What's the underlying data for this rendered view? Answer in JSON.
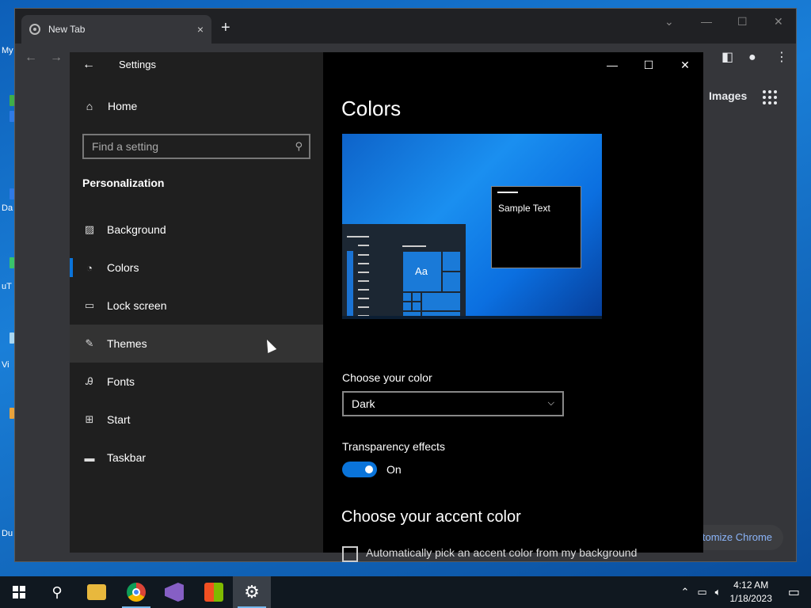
{
  "desktop": {
    "labels": [
      "My",
      "Da",
      "uT",
      "Vi",
      "Du"
    ],
    "icon_colors": [
      "#3fae49",
      "#2f7ae5",
      "#39c46b",
      "#a9d7f2",
      "#e8a33d"
    ]
  },
  "chrome": {
    "tab_title": "New Tab",
    "tab_close": "×",
    "new_tab": "+",
    "images_link": "Images",
    "customize": "tomize Chrome"
  },
  "settings": {
    "app_title": "Settings",
    "home_label": "Home",
    "search_placeholder": "Find a setting",
    "section_title": "Personalization",
    "nav": [
      {
        "label": "Background",
        "icon": "image-icon"
      },
      {
        "label": "Colors",
        "icon": "palette-icon",
        "selected": true
      },
      {
        "label": "Lock screen",
        "icon": "lock-screen-icon"
      },
      {
        "label": "Themes",
        "icon": "themes-icon",
        "hover": true
      },
      {
        "label": "Fonts",
        "icon": "fonts-icon"
      },
      {
        "label": "Start",
        "icon": "start-icon"
      },
      {
        "label": "Taskbar",
        "icon": "taskbar-icon"
      }
    ],
    "page_title": "Colors",
    "preview_tile_text": "Aa",
    "preview_sample_text": "Sample Text",
    "choose_color_label": "Choose your color",
    "choose_color_value": "Dark",
    "transparency_label": "Transparency effects",
    "transparency_state": "On",
    "accent_title": "Choose your accent color",
    "auto_accent_label": "Automatically pick an accent color from my background"
  },
  "taskbar": {
    "apps": [
      "file-explorer-icon",
      "chrome-icon",
      "visual-studio-icon",
      "store-icon",
      "settings-icon"
    ],
    "time": "4:12 AM",
    "date": "1/18/2023"
  },
  "colors": {
    "accent": "#0a74da",
    "sidebar_bg": "#1f1f1f",
    "content_bg": "#000000"
  }
}
